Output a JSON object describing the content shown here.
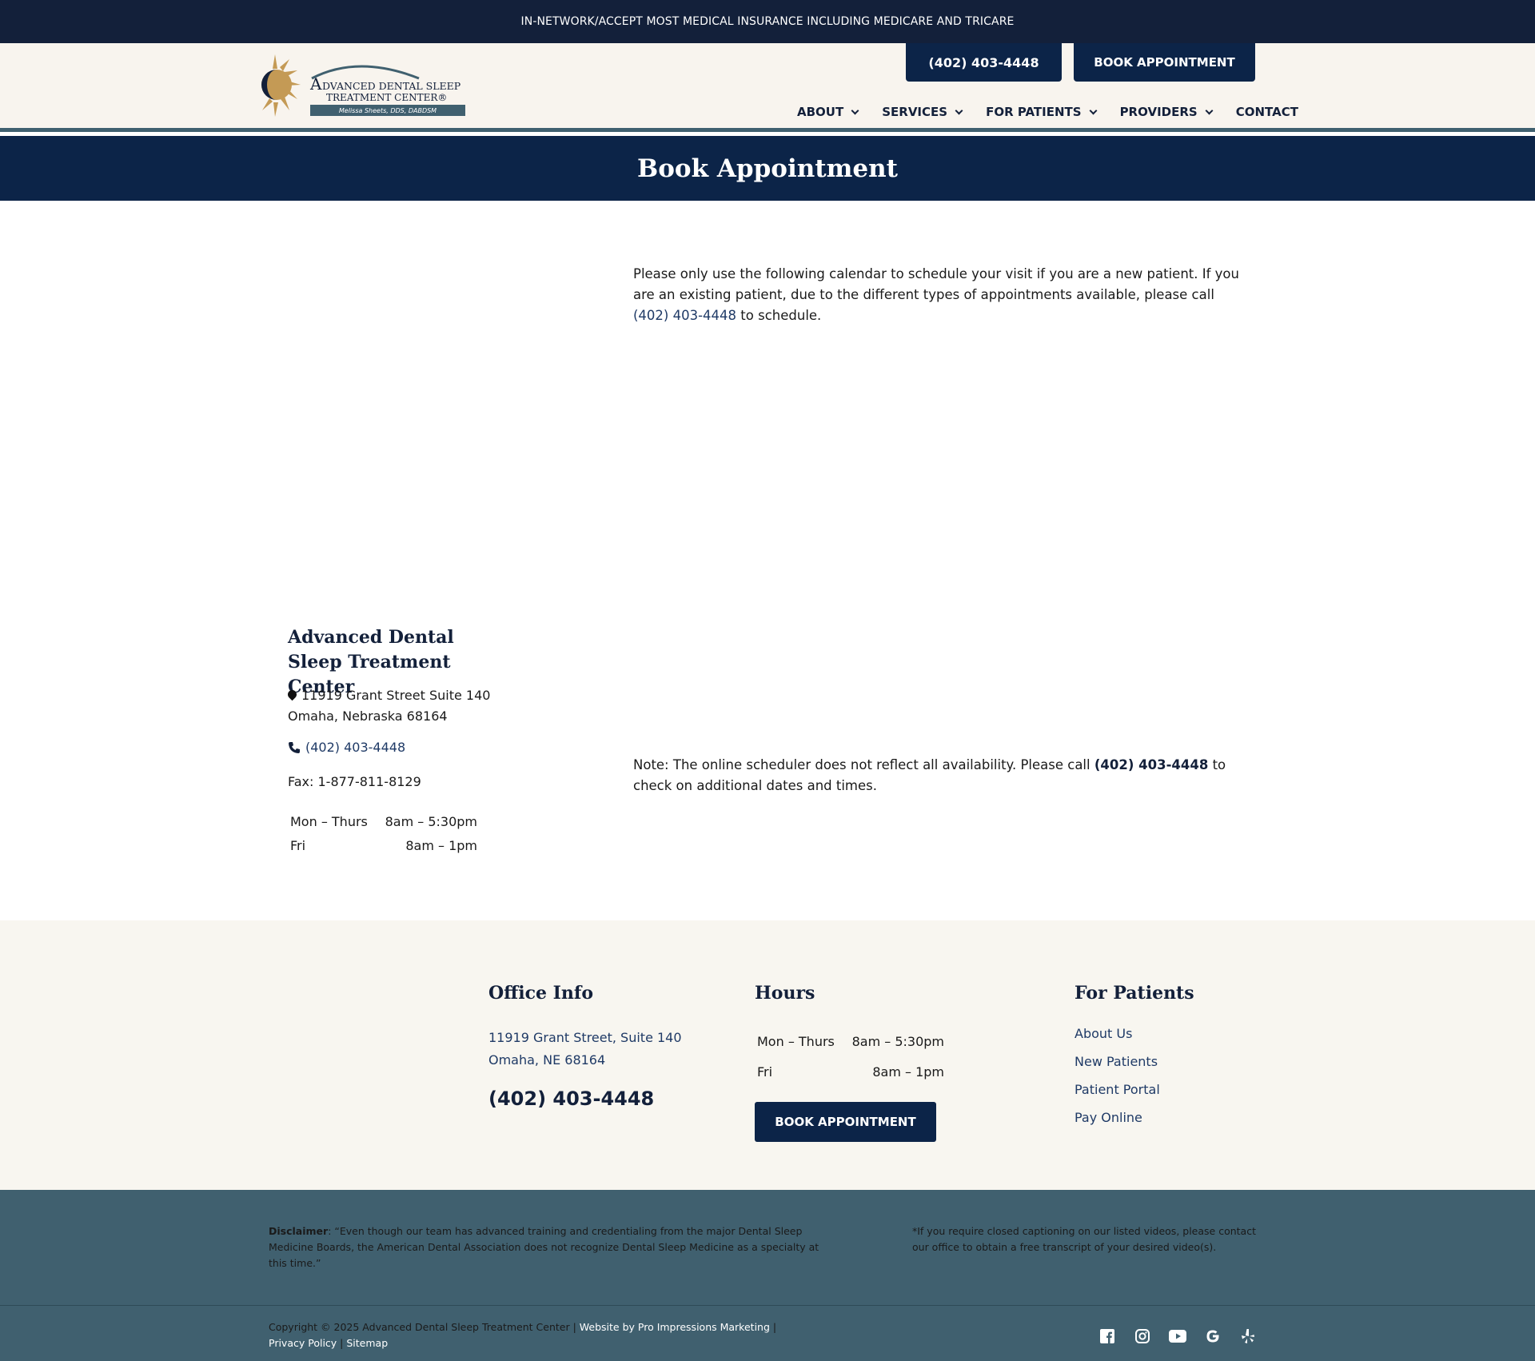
{
  "topbar": {
    "text": "IN-NETWORK/ACCEPT MOST MEDICAL INSURANCE INCLUDING MEDICARE AND TRICARE"
  },
  "header": {
    "logo": {
      "line1": "DVANCED DENTAL SLEEP",
      "initial": "A",
      "line2": "TREATMENT CENTER®",
      "doctor": "Melissa Sheets, DDS, DABDSM"
    },
    "phone_button": "(402) 403-4448",
    "book_button": "BOOK APPOINTMENT",
    "nav": [
      "ABOUT",
      "SERVICES",
      "FOR PATIENTS",
      "PROVIDERS",
      "CONTACT"
    ]
  },
  "page": {
    "title": "Book Appointment"
  },
  "intro": {
    "text_before": "Please only use the following calendar to schedule your  visit if you are a new patient. If you are an existing patient, due to the different types of appointments available, please call ",
    "phone": "(402) 403-4448",
    "text_after": " to schedule."
  },
  "office": {
    "name": "Advanced Dental Sleep Treatment Center",
    "address_line1": "11919 Grant Street Suite 140",
    "address_line2": "Omaha, Nebraska 68164",
    "phone": "(402) 403-4448",
    "fax": "Fax: 1-877-811-8129",
    "hours": [
      {
        "days": "Mon – Thurs",
        "time": "8am – 5:30pm"
      },
      {
        "days": "Fri",
        "time": "8am – 1pm"
      }
    ]
  },
  "note": {
    "text_before": "Note: The online scheduler does not reflect all availability. Please call ",
    "phone": "(402) 403-4448",
    "text_after": " to check on additional dates and times."
  },
  "footer": {
    "office_info": {
      "title": "Office Info",
      "address_line1": "11919 Grant Street, Suite 140",
      "address_line2": "Omaha, NE 68164",
      "phone": "(402) 403-4448"
    },
    "hours": {
      "title": "Hours",
      "rows": [
        {
          "days": "Mon – Thurs",
          "time": "8am – 5:30pm"
        },
        {
          "days": "Fri",
          "time": "8am – 1pm"
        }
      ],
      "book_button": "BOOK APPOINTMENT"
    },
    "for_patients": {
      "title": "For Patients",
      "links": [
        "About Us",
        "New Patients",
        "Patient Portal",
        "Pay Online"
      ]
    },
    "disclaimer_label": "Disclaimer",
    "disclaimer_text": ": “Even though our team has advanced training and credentialing from the major Dental Sleep Medicine Boards, the American Dental Association does not recognize Dental Sleep Medicine as a specialty at this time.”",
    "captions_text": "*If you require closed captioning on our listed videos, please contact our office to obtain a free transcript of your desired video(s).",
    "copyright_text": "Copyright © 2025 Advanced Dental Sleep Treatment Center | ",
    "website_by": "Website by Pro Impressions Marketing",
    "sep1": " | ",
    "privacy": "Privacy Policy",
    "sep2": " | ",
    "sitemap": "Sitemap",
    "social_icons": [
      "facebook-icon",
      "instagram-icon",
      "youtube-icon",
      "google-icon",
      "yelp-icon"
    ]
  },
  "colors": {
    "navy": "#0c2448",
    "dark_banner": "#13203a",
    "slate": "#40606f",
    "cream": "#f8f4ee",
    "gold": "#c49a55"
  }
}
